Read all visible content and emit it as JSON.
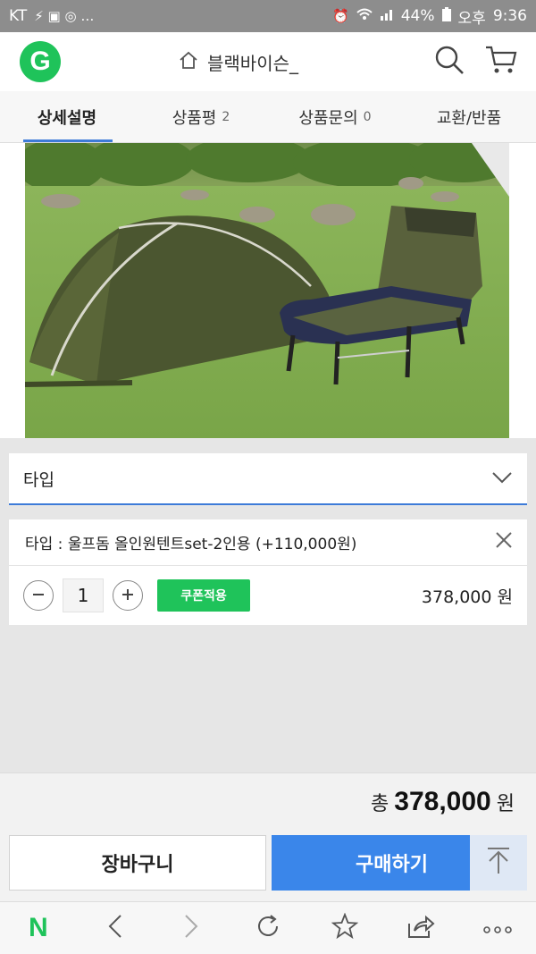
{
  "status_bar": {
    "carrier": "KT",
    "left_icons": "⚡ ▣ ◎ …",
    "battery": "44%",
    "ampm": "오후",
    "time": "9:36"
  },
  "header": {
    "logo": "G",
    "shop_name": "블랙바이슨_"
  },
  "tabs": [
    {
      "label": "상세설명",
      "count": ""
    },
    {
      "label": "상품평",
      "count": "2"
    },
    {
      "label": "상품문의",
      "count": "0"
    },
    {
      "label": "교환/반품",
      "count": ""
    }
  ],
  "option_select": {
    "label": "타입"
  },
  "selected_option": {
    "text": "타입 : 울프돔 올인원텐트set-2인용 (+110,000원)",
    "quantity": "1",
    "coupon_label": "쿠폰적용",
    "price": "378,000 원"
  },
  "total": {
    "label": "총",
    "value": "378,000",
    "unit": "원"
  },
  "actions": {
    "cart_label": "장바구니",
    "buy_label": "구매하기"
  },
  "browser_bar": {
    "home": "N"
  },
  "colors": {
    "accent_blue": "#3a86ea",
    "naver_green": "#1fc35a",
    "tab_underline": "#3d7bd8"
  }
}
